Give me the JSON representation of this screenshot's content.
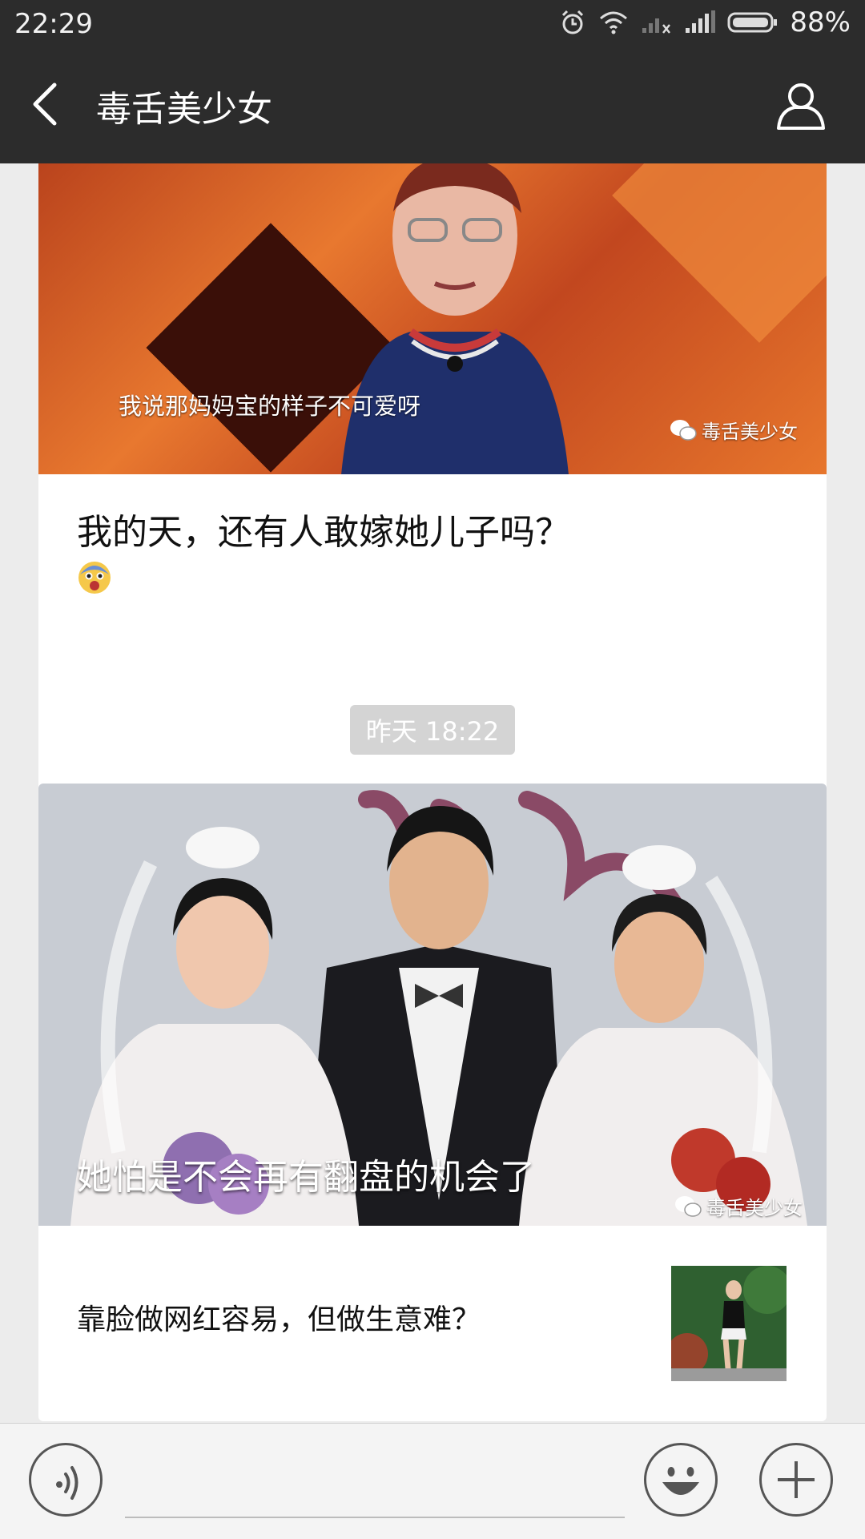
{
  "status_bar": {
    "time": "22:29",
    "battery": "88%"
  },
  "header": {
    "title": "毒舌美少女"
  },
  "messages": [
    {
      "image_caption": "我说那妈妈宝的样子不可爱呀",
      "watermark": "毒舌美少女",
      "headline": "我的天，还有人敢嫁她儿子吗？"
    },
    {
      "timestamp": "昨天 18:22",
      "image_caption": "她怕是不会再有翻盘的机会了",
      "watermark": "毒舌美少女",
      "story_title": "靠脸做网红容易，但做生意难？"
    }
  ],
  "colors": {
    "bar": "#2c2c2c",
    "background": "#ececec",
    "card": "#ffffff"
  }
}
